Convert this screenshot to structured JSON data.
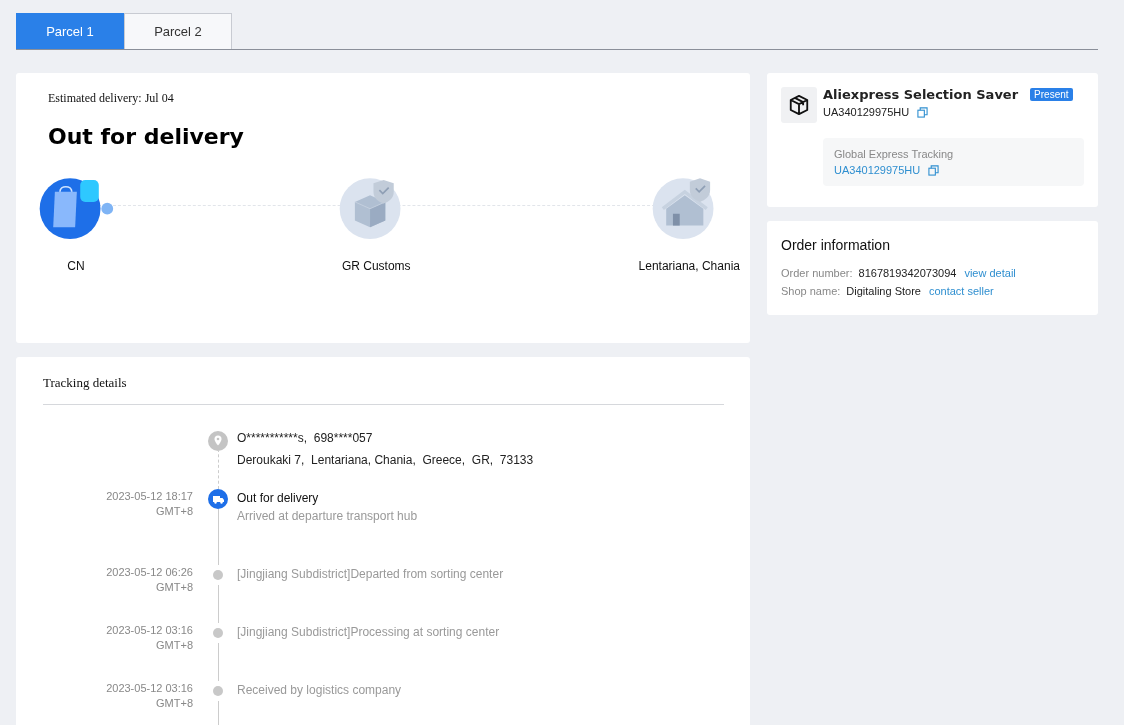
{
  "tabs": [
    {
      "label": "Parcel 1",
      "selected": true
    },
    {
      "label": "Parcel 2",
      "selected": false
    }
  ],
  "progress": {
    "estimate": "Estimated delivery: Jul 04",
    "status": "Out for delivery",
    "steps": [
      {
        "label": "CN",
        "kind": "bag",
        "active": true
      },
      {
        "label": "GR Customs",
        "kind": "box",
        "active": false
      },
      {
        "label": "Lentariana, Chania",
        "kind": "house",
        "active": false
      }
    ]
  },
  "tracking": {
    "title": "Tracking details",
    "address": {
      "recipient": "O***********s,  698****057",
      "line": "Deroukaki 7,  Lentariana, Chania,  Greece,  GR,  73133"
    },
    "events": [
      {
        "time": "2023-05-12 18:17",
        "zone": "GMT+8",
        "title": "Out for delivery",
        "detail": "Arrived at departure transport hub",
        "current": true
      },
      {
        "time": "2023-05-12 06:26",
        "zone": "GMT+8",
        "title": "[Jingjiang Subdistrict]Departed from sorting center",
        "current": false
      },
      {
        "time": "2023-05-12 03:16",
        "zone": "GMT+8",
        "title": "[Jingjiang Subdistrict]Processing at sorting center",
        "current": false
      },
      {
        "time": "2023-05-12 03:16",
        "zone": "GMT+8",
        "title": "Received by logistics company",
        "current": false
      }
    ]
  },
  "carrier": {
    "name": "Aliexpress Selection Saver",
    "badge": "Present",
    "number": "UA340129975HU",
    "partner_label": "Global Express Tracking",
    "partner_number": "UA340129975HU"
  },
  "order": {
    "title": "Order information",
    "rows": [
      {
        "label": "Order number:",
        "value": "8167819342073094",
        "link": "view detail"
      },
      {
        "label": "Shop name:",
        "value": "Digitaling Store",
        "link": "contact seller"
      }
    ]
  }
}
